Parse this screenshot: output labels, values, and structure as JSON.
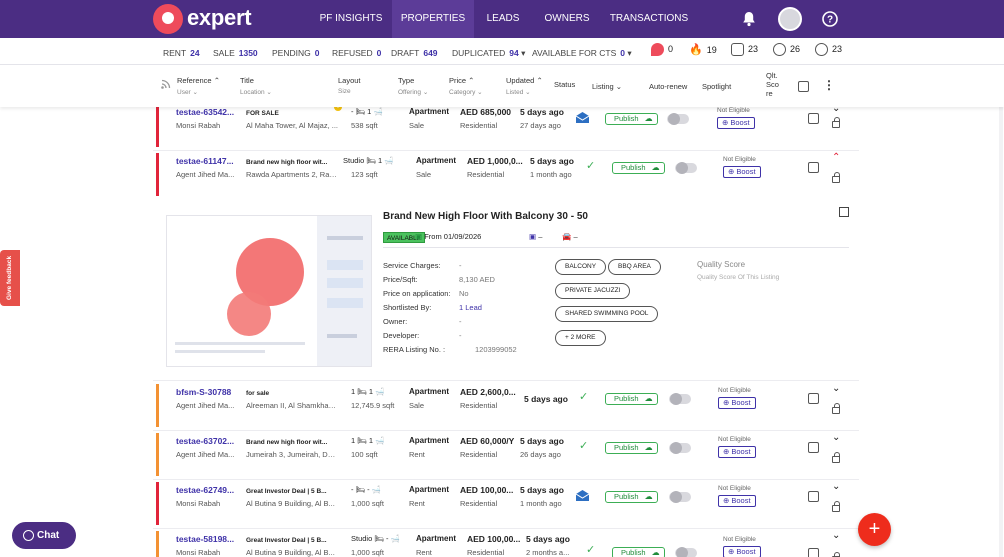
{
  "brand": {
    "name": "expert"
  },
  "nav": {
    "items": [
      "PF INSIGHTS",
      "PROPERTIES",
      "LEADS",
      "OWNERS",
      "TRANSACTIONS"
    ],
    "active": "PROPERTIES"
  },
  "stats": {
    "rent_label": "RENT",
    "rent": "24",
    "sale_label": "SALE",
    "sale": "1350",
    "pending_label": "PENDING",
    "pending": "0",
    "refused_label": "REFUSED",
    "refused": "0",
    "draft_label": "DRAFT",
    "draft": "649",
    "duplicated_label": "DUPLICATED",
    "duplicated": "94",
    "cts_label": "AVAILABLE FOR CTS",
    "cts": "0",
    "pf": "0",
    "hot": "19",
    "verified": "23",
    "premium": "26",
    "featured": "23"
  },
  "header": {
    "reference": "Reference",
    "user": "User",
    "title": "Title",
    "location": "Location",
    "layout": "Layout",
    "size": "Size",
    "type": "Type",
    "offering": "Offering",
    "price": "Price",
    "category": "Category",
    "updated": "Updated",
    "listed": "Listed",
    "status": "Status",
    "listing": "Listing",
    "autorenew": "Auto-renew",
    "spotlight": "Spotlight",
    "qlt_score": "Qlt. Sco re"
  },
  "rows": [
    {
      "ref": "testae-63542...",
      "user": "Monsi Rabah",
      "title": "FOR SALE",
      "location": "Al Maha Tower, Al Majaz, ...",
      "layout": "- 🛏 1 🛁",
      "size": "538 sqft",
      "type": "Apartment",
      "offering": "Sale",
      "price": "AED 685,000",
      "category": "Residential",
      "updated": "5 days ago",
      "listed": "27 days ago",
      "publish": "Publish",
      "not_eligible": "Not Eligible",
      "boost": "Boost"
    },
    {
      "ref": "testae-61147...",
      "user": "Agent Jihed Ma...",
      "title": "Brand new high floor wit...",
      "location": "Rawda Apartments 2, Raw...",
      "layout": "Studio 🛏 1 🛁",
      "size": "123 sqft",
      "type": "Apartment",
      "offering": "Sale",
      "price": "AED 1,000,0...",
      "category": "Residential",
      "updated": "5 days ago",
      "listed": "1 month ago",
      "publish": "Publish",
      "not_eligible": "Not Eligible",
      "boost": "Boost"
    },
    {
      "ref": "bfsm-S-30788",
      "user": "Agent Jihed Ma...",
      "title": "for sale",
      "location": "Alreeman II, Al Shamkha, ...",
      "layout": "1 🛏 1 🛁",
      "size": "12,745.9 sqft",
      "type": "Apartment",
      "offering": "Sale",
      "price": "AED 2,600,0...",
      "category": "Residential",
      "updated": "5 days ago",
      "listed": "",
      "publish": "Publish",
      "not_eligible": "Not Eligible",
      "boost": "Boost"
    },
    {
      "ref": "testae-63702...",
      "user": "Agent Jihed Ma...",
      "title": "Brand new high floor wit...",
      "location": "Jumeirah 3, Jumeirah, Du...",
      "layout": "1 🛏 1 🛁",
      "size": "100 sqft",
      "type": "Apartment",
      "offering": "Rent",
      "price": "AED 60,000/Y",
      "category": "Residential",
      "updated": "5 days ago",
      "listed": "26 days ago",
      "publish": "Publish",
      "not_eligible": "Not Eligible",
      "boost": "Boost"
    },
    {
      "ref": "testae-62749...",
      "user": "Monsi Rabah",
      "title": "Great Investor Deal | 5 B...",
      "location": "Al Butina 9 Building, Al B...",
      "layout": "- 🛏 - 🛁",
      "size": "1,000 sqft",
      "type": "Apartment",
      "offering": "Rent",
      "price": "AED 100,00...",
      "category": "Residential",
      "updated": "5 days ago",
      "listed": "1 month ago",
      "publish": "Publish",
      "not_eligible": "Not Eligible",
      "boost": "Boost"
    },
    {
      "ref": "testae-58198...",
      "user": "Monsi Rabah",
      "title": "Great Investor Deal | 5 B...",
      "location": "Al Butina 9 Building, Al B...",
      "layout": "Studio 🛏 - 🛁",
      "size": "1,000 sqft",
      "type": "Apartment",
      "offering": "Rent",
      "price": "AED 100,00...",
      "category": "Residential",
      "updated": "5 days ago",
      "listed": "2 months a...",
      "publish": "Publish",
      "not_eligible": "Not Eligible",
      "boost": "Boost"
    }
  ],
  "detail": {
    "title": "Brand New High Floor With Balcony 30 - 50",
    "available": "AVAILABLE",
    "from": "From 01/09/2026",
    "dash": "–",
    "service_label": "Service Charges:",
    "service": "-",
    "price_sqft_label": "Price/Sqft:",
    "price_sqft": "8,130 AED",
    "poa_label": "Price on application:",
    "poa": "No",
    "shortlisted_label": "Shortlisted By:",
    "shortlisted": "1 Lead",
    "owner_label": "Owner:",
    "owner": "-",
    "developer_label": "Developer:",
    "developer": "-",
    "rera_label": "RERA Listing No. :",
    "rera": "1203999052",
    "amenities": [
      "BALCONY",
      "BBQ AREA",
      "PRIVATE JACUZZI",
      "SHARED SWIMMING POOL",
      "+ 2 MORE"
    ],
    "quality_score": "Quality Score",
    "quality_sub": "Quality Score Of This Listing"
  },
  "feedback": "Give feedback",
  "chat": "Chat",
  "fab": "+",
  "colors": {
    "brand": "#4b2d83",
    "red": "#e1243a",
    "orange": "#f39233",
    "link": "#3f32a8",
    "green": "#3cae55",
    "fab": "#ee2c1c"
  }
}
